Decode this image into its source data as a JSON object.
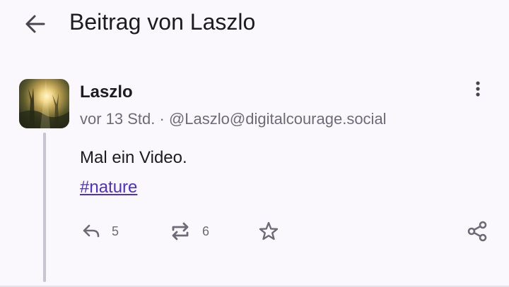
{
  "header": {
    "title": "Beitrag von Laszlo",
    "back_icon": "arrow-left-icon"
  },
  "post": {
    "author": "Laszlo",
    "time": "vor 13 Std.",
    "separator": "·",
    "handle": "@Laszlo@digitalcourage.social",
    "content": "Mal ein Video.",
    "hashtag": "#nature",
    "actions": {
      "reply_count": "5",
      "boost_count": "6"
    }
  },
  "colors": {
    "background": "#faf8fd",
    "text": "#1c1b1f",
    "muted": "#6f6b76",
    "link": "#4f2ecf",
    "thread_line": "#c9c5d0"
  }
}
